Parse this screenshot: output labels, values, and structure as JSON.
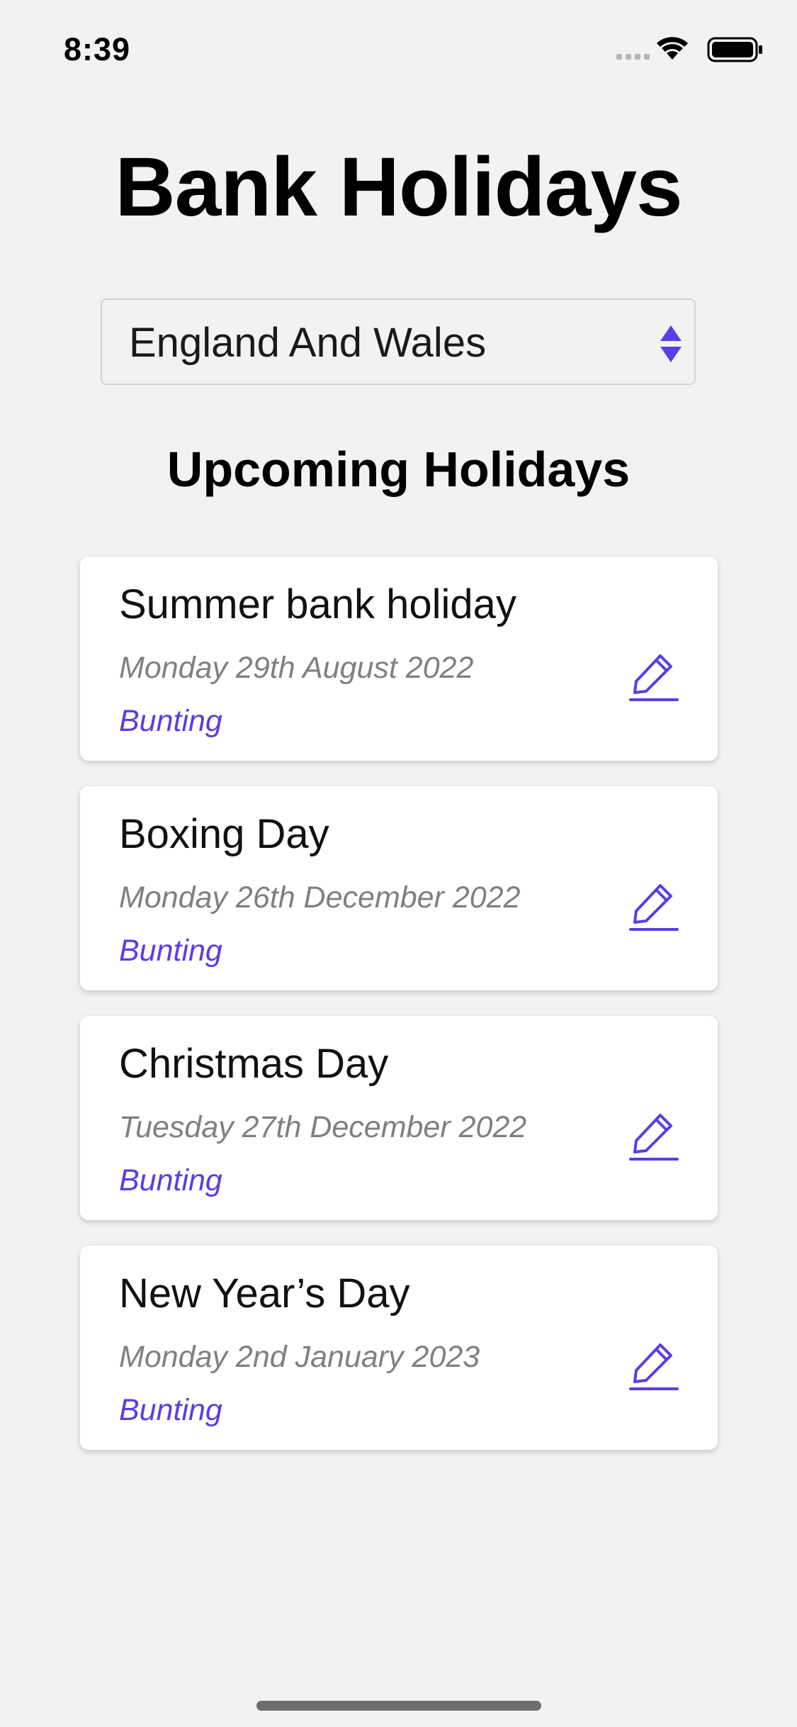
{
  "status_bar": {
    "time": "8:39"
  },
  "header": {
    "title": "Bank Holidays"
  },
  "region_select": {
    "selected": "England And Wales"
  },
  "section": {
    "title": "Upcoming Holidays"
  },
  "holidays": [
    {
      "name": "Summer bank holiday",
      "date": "Monday 29th August 2022",
      "tag": "Bunting"
    },
    {
      "name": "Boxing Day",
      "date": "Monday 26th December 2022",
      "tag": "Bunting"
    },
    {
      "name": "Christmas Day",
      "date": "Tuesday 27th December 2022",
      "tag": "Bunting"
    },
    {
      "name": "New Year’s Day",
      "date": "Monday 2nd January 2023",
      "tag": "Bunting"
    }
  ],
  "icons": {
    "edit": "pencil-icon",
    "select": "chevron-up-down-icon"
  },
  "colors": {
    "accent": "#5b3ce6",
    "background": "#f2f2f2",
    "card": "#ffffff",
    "date_text": "#808080"
  }
}
